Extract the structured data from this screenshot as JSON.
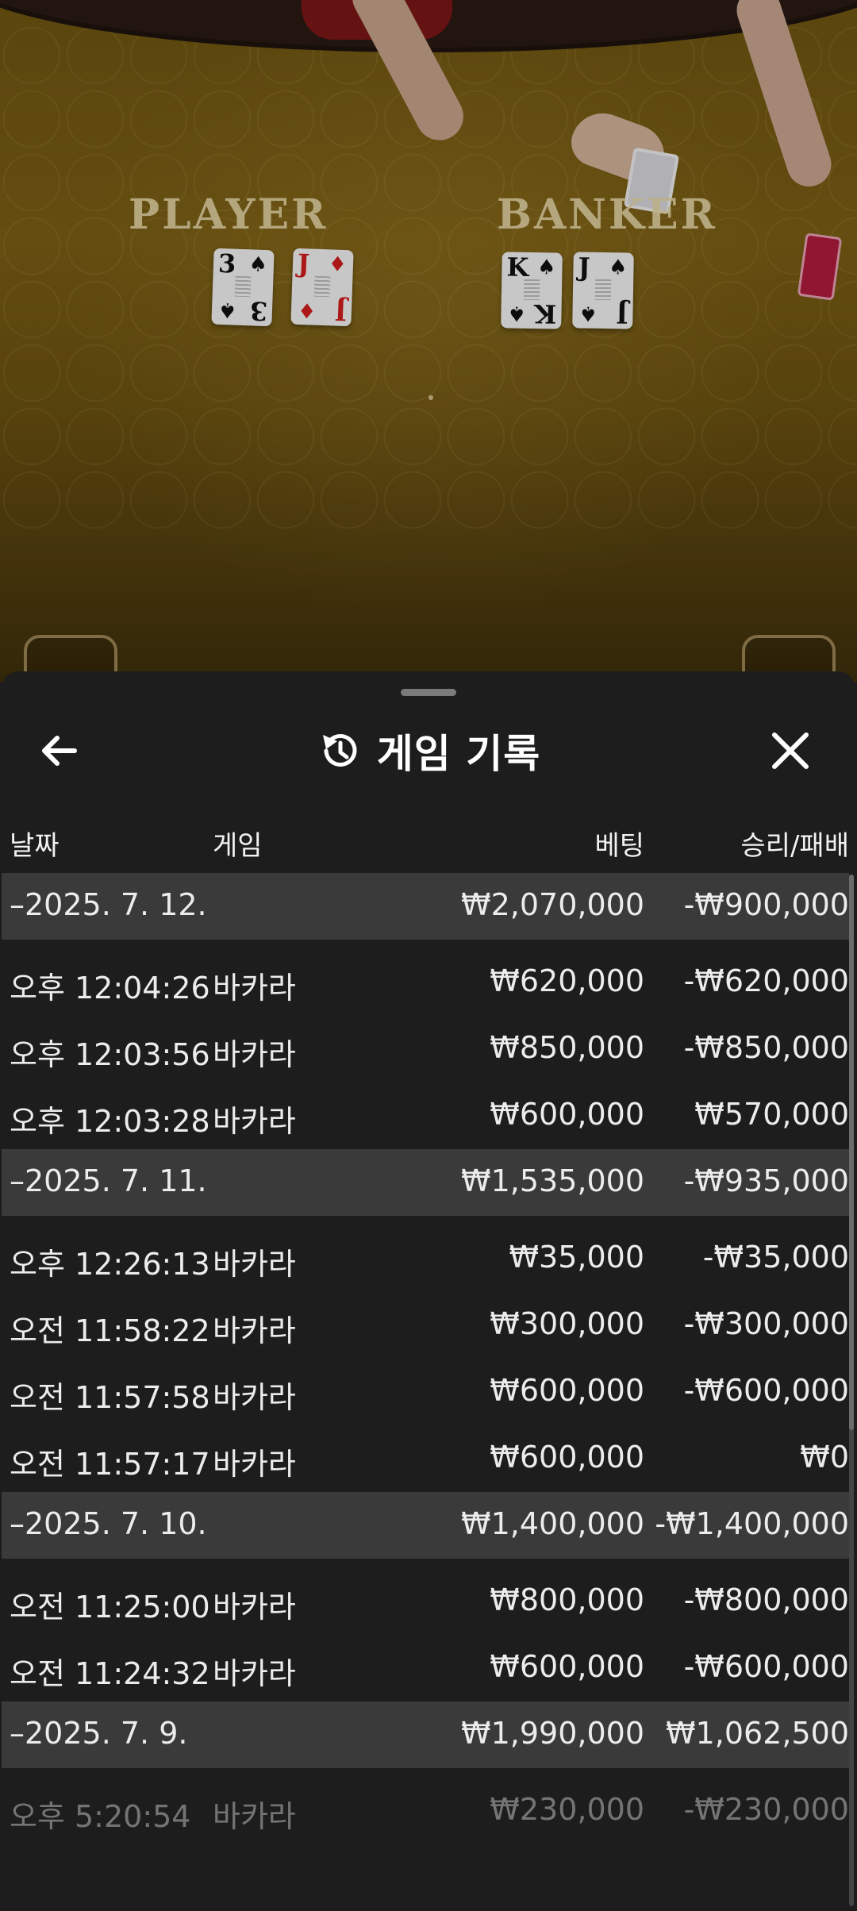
{
  "table": {
    "player_label": "PLAYER",
    "banker_label": "BANKER",
    "player_cards": [
      {
        "rank": "3",
        "suit": "♠",
        "color": "black"
      },
      {
        "rank": "J",
        "suit": "♦",
        "color": "red"
      }
    ],
    "banker_cards": [
      {
        "rank": "K",
        "suit": "♠",
        "color": "black"
      },
      {
        "rank": "J",
        "suit": "♠",
        "color": "black"
      }
    ]
  },
  "sheet": {
    "title": "게임 기록",
    "back_icon": "arrow-left-icon",
    "history_icon": "history-icon",
    "close_icon": "close-icon",
    "columns": {
      "date": "날짜",
      "game": "게임",
      "bet": "베팅",
      "result": "승리/패배"
    },
    "groups": [
      {
        "date": "–2025. 7. 12.",
        "bet": "₩2,070,000",
        "result": "-₩900,000",
        "rows": [
          {
            "time": "오후 12:04:26",
            "game": "바카라",
            "bet": "₩620,000",
            "result": "-₩620,000"
          },
          {
            "time": "오후 12:03:56",
            "game": "바카라",
            "bet": "₩850,000",
            "result": "-₩850,000"
          },
          {
            "time": "오후 12:03:28",
            "game": "바카라",
            "bet": "₩600,000",
            "result": "₩570,000"
          }
        ]
      },
      {
        "date": "–2025. 7. 11.",
        "bet": "₩1,535,000",
        "result": "-₩935,000",
        "rows": [
          {
            "time": "오후 12:26:13",
            "game": "바카라",
            "bet": "₩35,000",
            "result": "-₩35,000"
          },
          {
            "time": "오전 11:58:22",
            "game": "바카라",
            "bet": "₩300,000",
            "result": "-₩300,000"
          },
          {
            "time": "오전 11:57:58",
            "game": "바카라",
            "bet": "₩600,000",
            "result": "-₩600,000"
          },
          {
            "time": "오전 11:57:17",
            "game": "바카라",
            "bet": "₩600,000",
            "result": "₩0"
          }
        ]
      },
      {
        "date": "–2025. 7. 10.",
        "bet": "₩1,400,000",
        "result": "-₩1,400,000",
        "rows": [
          {
            "time": "오전 11:25:00",
            "game": "바카라",
            "bet": "₩800,000",
            "result": "-₩800,000"
          },
          {
            "time": "오전 11:24:32",
            "game": "바카라",
            "bet": "₩600,000",
            "result": "-₩600,000"
          }
        ]
      },
      {
        "date": "–2025. 7. 9.",
        "bet": "₩1,990,000",
        "result": "₩1,062,500",
        "rows": [
          {
            "time": "오후 5:20:54",
            "game": "바카라",
            "bet": "₩230,000",
            "result": "-₩230,000"
          }
        ]
      }
    ]
  }
}
